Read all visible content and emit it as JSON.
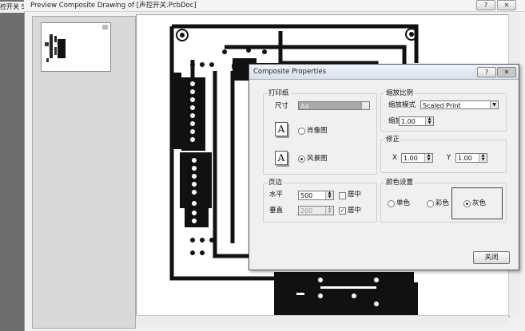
{
  "left_tab": {
    "label": "控开关 Sc"
  },
  "window": {
    "title": "Preview Composite Drawing of [声控开关.PcbDoc]",
    "help_label": "?",
    "close_label": "✕"
  },
  "dialog": {
    "title": "Composite Properties",
    "help_label": "?",
    "close_label": "✕",
    "paper": {
      "legend": "打印纸",
      "size_label": "尺寸",
      "size_value": "A4",
      "portrait_label": "肖像图",
      "landscape_label": "风景图",
      "selected": "landscape"
    },
    "scaling": {
      "legend": "缩放比例",
      "mode_label": "缩放模式",
      "mode_value": "Scaled Print",
      "scale_label": "缩放",
      "scale_value": "1.00"
    },
    "correction": {
      "legend": "修正",
      "x_label": "X",
      "x_value": "1.00",
      "y_label": "Y",
      "y_value": "1.00"
    },
    "margins": {
      "legend": "页边",
      "horizontal_label": "水平",
      "horizontal_value": "500",
      "horizontal_center": false,
      "vertical_label": "垂直",
      "vertical_value": "200",
      "vertical_center": true,
      "center_label": "居中"
    },
    "color": {
      "legend": "颜色设置",
      "mono_label": "单色",
      "color_label": "彩色",
      "gray_label": "灰色",
      "selected": "gray"
    },
    "close_button": "关闭"
  },
  "colors": {
    "pcb_ink": "#111111",
    "sheet": "#ffffff",
    "dialog_bg": "#f0f0f0"
  }
}
